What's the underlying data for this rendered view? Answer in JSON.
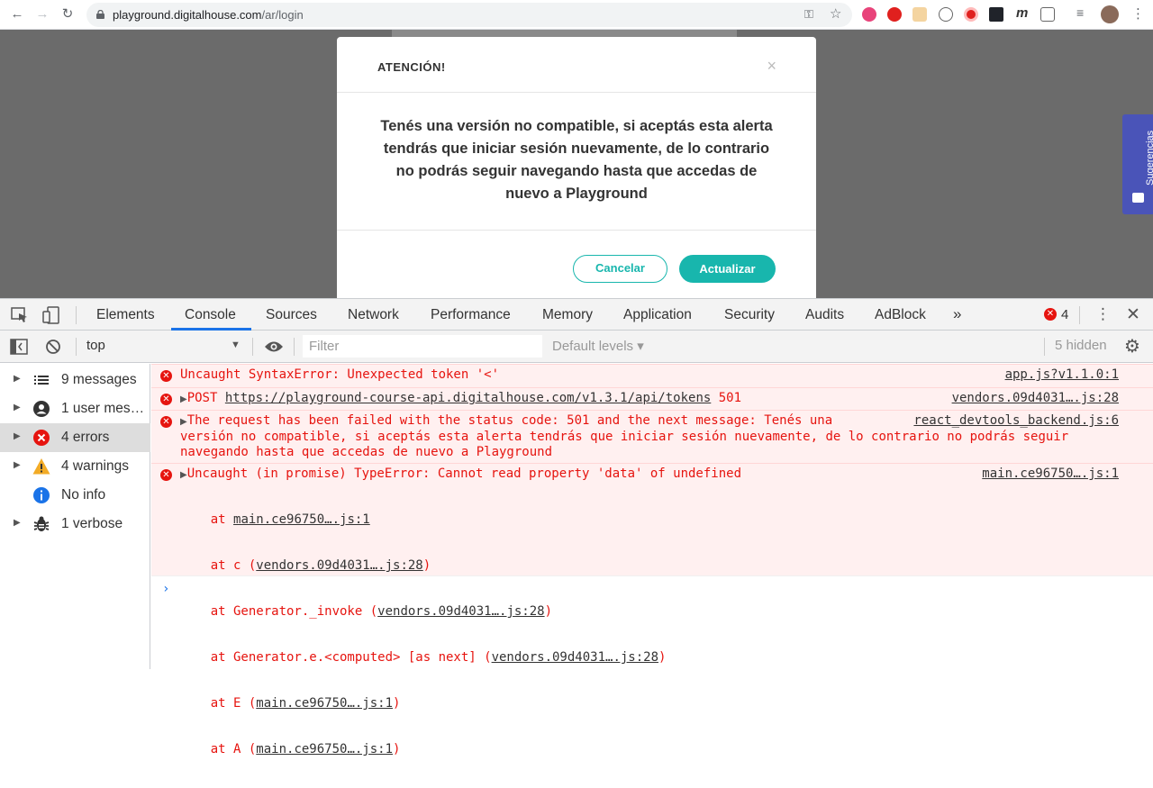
{
  "browser": {
    "url_host": "playground.digitalhouse.com",
    "url_path": "/ar/login"
  },
  "modal": {
    "title": "ATENCIÓN!",
    "close": "×",
    "body": "Tenés una versión no compatible, si aceptás esta alerta tendrás que iniciar sesión nuevamente, de lo contrario no podrás seguir navegando hasta que accedas de nuevo a Playground",
    "cancel_label": "Cancelar",
    "update_label": "Actualizar"
  },
  "suggestions_tab": {
    "label": "Sugerencias"
  },
  "devtools": {
    "tabs": [
      "Elements",
      "Console",
      "Sources",
      "Network",
      "Performance",
      "Memory",
      "Application",
      "Security",
      "Audits",
      "AdBlock"
    ],
    "active_tab": "Console",
    "more_tabs": "»",
    "error_count": "4",
    "context": "top",
    "filter_placeholder": "Filter",
    "levels": "Default levels ▾",
    "hidden": "5 hidden",
    "sidebar": [
      {
        "label": "9 messages",
        "icon": "list-icon"
      },
      {
        "label": "1 user mes…",
        "icon": "user-icon"
      },
      {
        "label": "4 errors",
        "icon": "error-icon"
      },
      {
        "label": "4 warnings",
        "icon": "warning-icon"
      },
      {
        "label": "No info",
        "icon": "info-icon"
      },
      {
        "label": "1 verbose",
        "icon": "bug-icon"
      }
    ],
    "messages": [
      {
        "text": "Uncaught SyntaxError: Unexpected token '<'",
        "source": "app.js?v1.1.0:1"
      },
      {
        "text_prefix": "POST ",
        "link": "https://playground-course-api.digitalhouse.com/v1.3.1/api/tokens",
        "text_suffix": " 501",
        "source": "vendors.09d4031….js:28"
      },
      {
        "text": "The request has been failed with the status code: 501 and the next message: Tenés una\nversión no compatible, si aceptás esta alerta tendrás que iniciar sesión nuevamente, de lo contrario no podrás seguir\nnavegando hasta que accedas de nuevo a Playground",
        "source": "react_devtools_backend.js:6"
      },
      {
        "text": "Uncaught (in promise) TypeError: Cannot read property 'data' of undefined",
        "source": "main.ce96750….js:1",
        "stack": [
          {
            "pre": "    at ",
            "link": "main.ce96750….js:1",
            "post": ""
          },
          {
            "pre": "    at c (",
            "link": "vendors.09d4031….js:28",
            "post": ")"
          },
          {
            "pre": "    at Generator._invoke (",
            "link": "vendors.09d4031….js:28",
            "post": ")"
          },
          {
            "pre": "    at Generator.e.<computed> [as next] (",
            "link": "vendors.09d4031….js:28",
            "post": ")"
          },
          {
            "pre": "    at E (",
            "link": "main.ce96750….js:1",
            "post": ")"
          },
          {
            "pre": "    at A (",
            "link": "main.ce96750….js:1",
            "post": ")"
          }
        ]
      }
    ],
    "prompt": "›"
  }
}
